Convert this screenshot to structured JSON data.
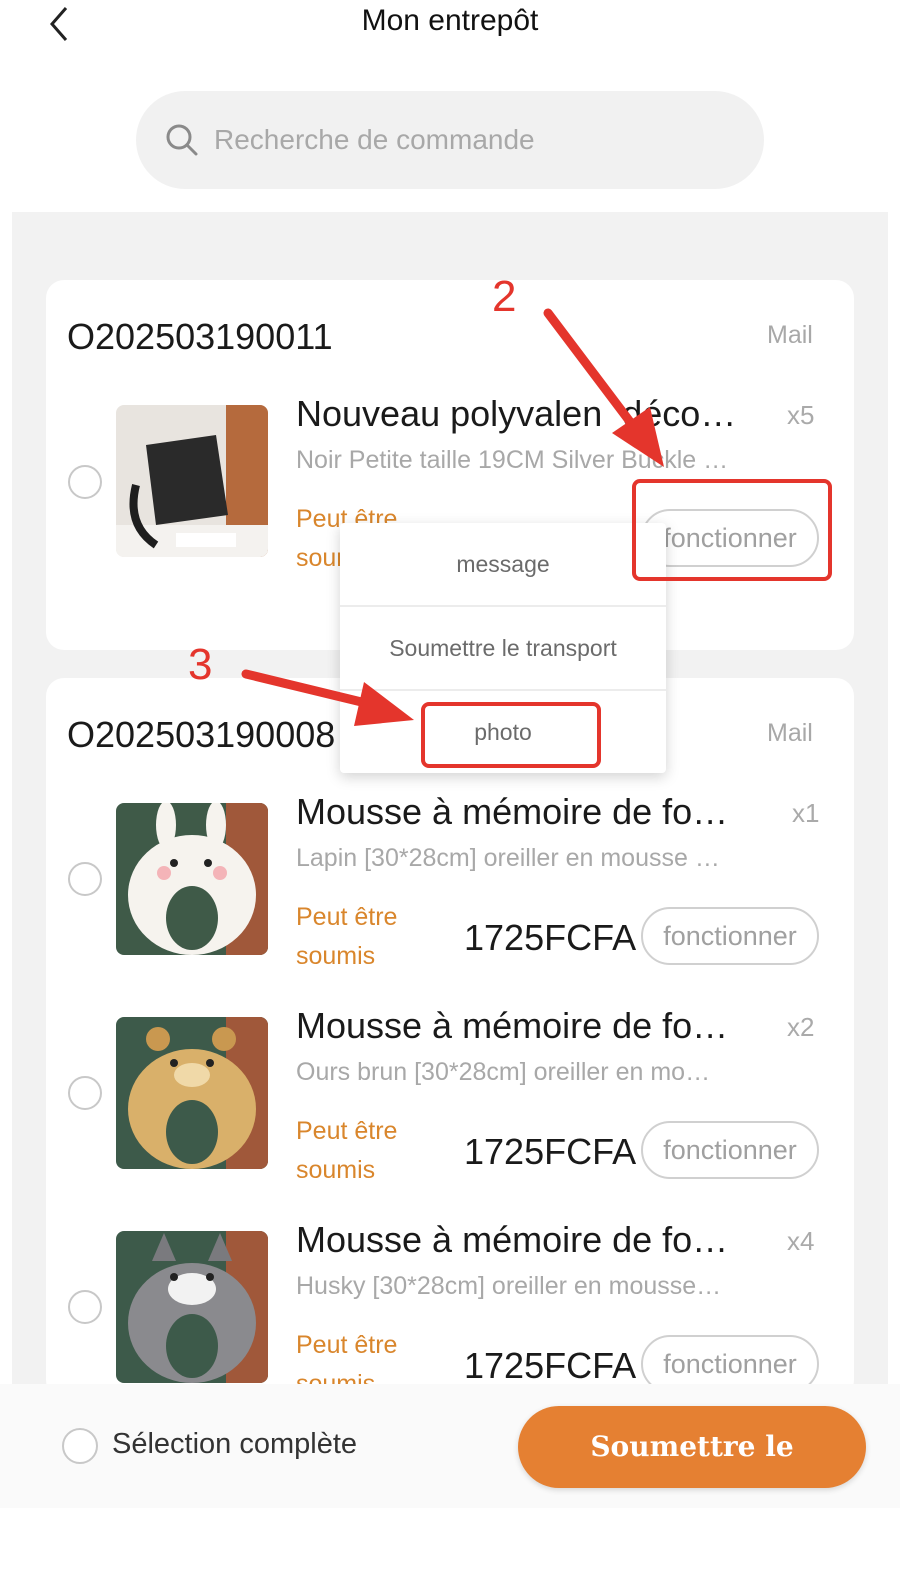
{
  "header": {
    "title": "Mon entrepôt"
  },
  "search": {
    "placeholder": "Recherche de commande"
  },
  "orders": [
    {
      "id": "O202503190011",
      "carrier": "Mail",
      "items": [
        {
          "name": "Nouveau polyvalen  déco…",
          "qty": "x5",
          "variant": "Noir Petite taille 19CM Silver Buckle …",
          "status": "Peut être soumis",
          "action": "fonctionner"
        }
      ]
    },
    {
      "id": "O202503190008",
      "carrier": "Mail",
      "items": [
        {
          "name": "Mousse à mémoire de fo…",
          "qty": "x1",
          "variant": "Lapin [30*28cm] oreiller en mousse …",
          "status": "Peut être soumis",
          "price": "1725FCFA",
          "action": "fonctionner"
        },
        {
          "name": "Mousse à mémoire de fo…",
          "qty": "x2",
          "variant": "Ours brun [30*28cm] oreiller en mo…",
          "status": "Peut être soumis",
          "price": "1725FCFA",
          "action": "fonctionner"
        },
        {
          "name": "Mousse à mémoire de fo…",
          "qty": "x4",
          "variant": "Husky [30*28cm] oreiller en mousse…",
          "status": "Peut être soumis",
          "price": "1725FCFA",
          "action": "fonctionner"
        }
      ]
    }
  ],
  "popup_menu": {
    "items": [
      "message",
      "Soumettre le transport",
      "photo"
    ]
  },
  "annotations": {
    "step2": "2",
    "step3": "3"
  },
  "footer": {
    "select_all": "Sélection complète",
    "submit": "Soumettre le transport"
  },
  "colors": {
    "accent": "#e58032",
    "status": "#d9862c",
    "annotation": "#e4352c"
  }
}
